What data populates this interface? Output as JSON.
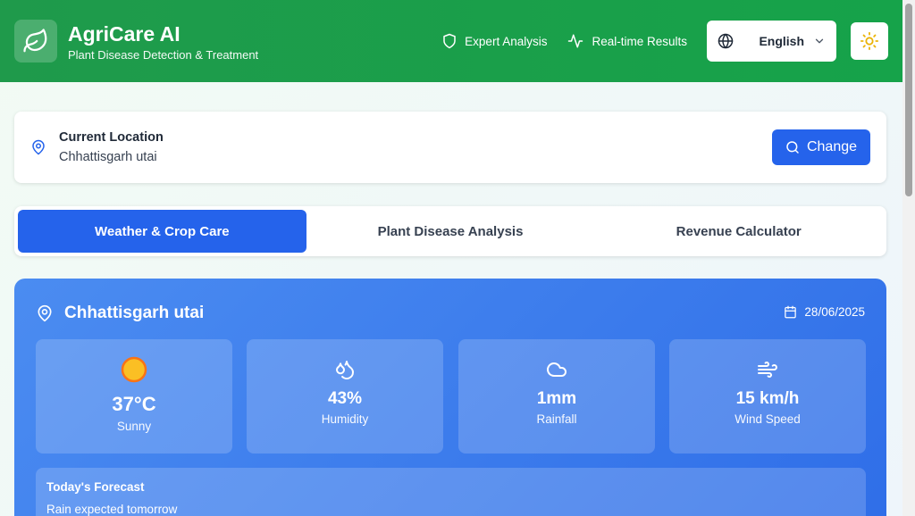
{
  "header": {
    "app_title": "AgriCare AI",
    "app_subtitle": "Plant Disease Detection & Treatment",
    "features": [
      "Expert Analysis",
      "Real-time Results"
    ],
    "language": "English",
    "brand_color": "#16a34a"
  },
  "location": {
    "label": "Current Location",
    "value": "Chhattisgarh utai",
    "change_label": "Change"
  },
  "tabs": [
    {
      "label": "Weather & Crop Care",
      "active": true
    },
    {
      "label": "Plant Disease Analysis",
      "active": false
    },
    {
      "label": "Revenue Calculator",
      "active": false
    }
  ],
  "weather": {
    "city": "Chhattisgarh utai",
    "date": "28/06/2025",
    "stats": [
      {
        "icon": "sun-icon",
        "value": "37°C",
        "label": "Sunny"
      },
      {
        "icon": "droplets-icon",
        "value": "43%",
        "label": "Humidity"
      },
      {
        "icon": "cloud-icon",
        "value": "1mm",
        "label": "Rainfall"
      },
      {
        "icon": "wind-icon",
        "value": "15 km/h",
        "label": "Wind Speed"
      }
    ],
    "forecast": {
      "title": "Today's Forecast",
      "text": "Rain expected tomorrow"
    }
  }
}
